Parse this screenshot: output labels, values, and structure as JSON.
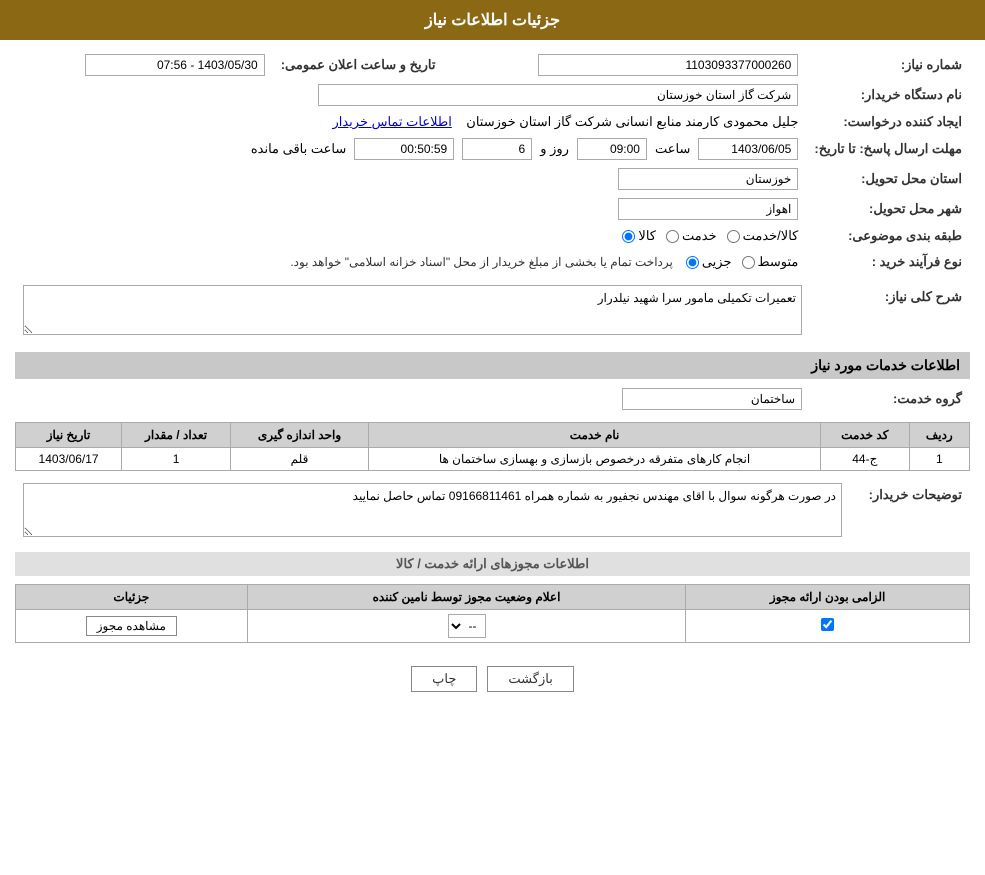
{
  "header": {
    "title": "جزئیات اطلاعات نیاز"
  },
  "fields": {
    "need_number_label": "شماره نیاز:",
    "need_number_value": "1103093377000260",
    "buyer_org_label": "نام دستگاه خریدار:",
    "buyer_org_value": "شرکت گاز استان خوزستان",
    "creator_label": "ایجاد کننده درخواست:",
    "creator_value": "جلیل محمودی کارمند منابع انسانی شرکت گاز استان خوزستان",
    "creator_link": "اطلاعات تماس خریدار",
    "announce_date_label": "تاریخ و ساعت اعلان عمومی:",
    "announce_date_value": "1403/05/30 - 07:56",
    "response_deadline_label": "مهلت ارسال پاسخ: تا تاریخ:",
    "response_date": "1403/06/05",
    "response_time": "09:00",
    "response_days": "6",
    "response_countdown": "00:50:59",
    "response_time_label": "ساعت",
    "response_days_label": "روز و",
    "response_remaining_label": "ساعت باقی مانده",
    "province_label": "استان محل تحویل:",
    "province_value": "خوزستان",
    "city_label": "شهر محل تحویل:",
    "city_value": "اهواز",
    "category_label": "طبقه بندی موضوعی:",
    "category_options": [
      "کالا",
      "خدمت",
      "کالا/خدمت"
    ],
    "category_selected": "کالا",
    "purchase_type_label": "نوع فرآیند خرید :",
    "purchase_options": [
      "جزیی",
      "متوسط"
    ],
    "purchase_notice": "پرداخت تمام یا بخشی از مبلغ خریدار از محل \"اسناد خزانه اسلامی\" خواهد بود.",
    "general_desc_label": "شرح کلی نیاز:",
    "general_desc_value": "تعمیرات تکمیلی مامور سرا شهید نیلدرار",
    "services_section": "اطلاعات خدمات مورد نیاز",
    "service_group_label": "گروه خدمت:",
    "service_group_value": "ساختمان",
    "table_headers": {
      "row_num": "ردیف",
      "service_code": "کد خدمت",
      "service_name": "نام خدمت",
      "unit": "واحد اندازه گیری",
      "quantity": "تعداد / مقدار",
      "date": "تاریخ نیاز"
    },
    "table_rows": [
      {
        "row_num": "1",
        "service_code": "ج-44",
        "service_name": "انجام کارهای متفرقه درخصوص بازسازی و بهسازی ساختمان ها",
        "unit": "قلم",
        "quantity": "1",
        "date": "1403/06/17"
      }
    ],
    "buyer_notes_label": "توضیحات خریدار:",
    "buyer_notes_value": "در صورت هرگونه سوال با اقای مهندس نجفیور به شماره همراه 09166811461 تماس حاصل نمایید",
    "permissions_section": "اطلاعات مجوزهای ارائه خدمت / کالا",
    "perm_table_headers": {
      "mandatory": "الزامی بودن ارائه مجوز",
      "supplier_status": "اعلام وضعیت مجوز توسط نامین کننده",
      "details": "جزئیات"
    },
    "perm_rows": [
      {
        "mandatory": true,
        "supplier_status": "--",
        "details_btn": "مشاهده مجوز"
      }
    ],
    "buttons": {
      "print": "چاپ",
      "back": "بازگشت"
    }
  }
}
